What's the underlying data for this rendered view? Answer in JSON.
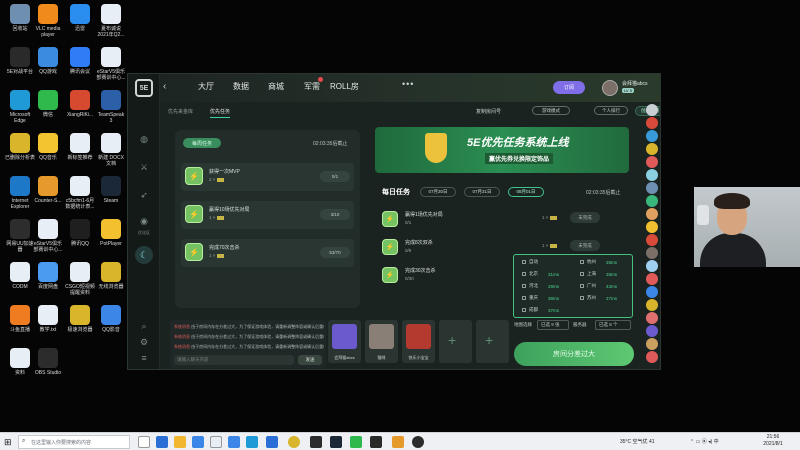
{
  "desktop_icons": [
    {
      "label": "回收站",
      "icon": "recycle-bin-icon",
      "color": "#6f8fb0"
    },
    {
      "label": "VLC media\nplayer",
      "icon": "vlc-icon",
      "color": "#f08a1d"
    },
    {
      "label": "迅雷",
      "icon": "thunder-icon",
      "color": "#2a8ef0"
    },
    {
      "label": "夏布诚说\n2021年Q2...",
      "icon": "document-icon",
      "color": "#e8eef5"
    },
    {
      "label": "5E对战平台",
      "icon": "5e-icon",
      "color": "#2a2a2a"
    },
    {
      "label": "QQ游戏",
      "icon": "qqgame-icon",
      "color": "#3b8be0"
    },
    {
      "label": "腾讯会议",
      "icon": "meeting-icon",
      "color": "#2f7cf6"
    },
    {
      "label": "eStarV5俱乐\n部赛训中心...",
      "icon": "document-icon",
      "color": "#e8eef5"
    },
    {
      "label": "Microsoft\nEdge",
      "icon": "edge-icon",
      "color": "#1f9ad6"
    },
    {
      "label": "微信",
      "icon": "wechat-icon",
      "color": "#2fb84b"
    },
    {
      "label": "XiangRiKi...",
      "icon": "app-icon",
      "color": "#d64a2f"
    },
    {
      "label": "TeamSpeak\n3",
      "icon": "teamspeak-icon",
      "color": "#2b5fa8"
    },
    {
      "label": "已删除分析表",
      "icon": "chrome-icon",
      "color": "#d9b52c"
    },
    {
      "label": "QQ音乐",
      "icon": "qqmusic-icon",
      "color": "#f4c430"
    },
    {
      "label": "新标签推荐",
      "icon": "document-icon",
      "color": "#e8eef5"
    },
    {
      "label": "新建 DOCX\n文档",
      "icon": "docx-icon",
      "color": "#e8eef5"
    },
    {
      "label": "Internet\nExplorer",
      "icon": "ie-icon",
      "color": "#1e78c8"
    },
    {
      "label": "Counter-S...",
      "icon": "csgo-icon",
      "color": "#e59a2b"
    },
    {
      "label": "c5bcfm1-6月\n数据统计表...",
      "icon": "document-icon",
      "color": "#e8eef5"
    },
    {
      "label": "Steam",
      "icon": "steam-icon",
      "color": "#1b2838"
    },
    {
      "label": "网易UU加速\n器",
      "icon": "uu-icon",
      "color": "#2d2d2d"
    },
    {
      "label": "eStarV5俱乐\n部赛训中心...",
      "icon": "document-icon",
      "color": "#e8eef5"
    },
    {
      "label": "腾讯QQ",
      "icon": "qq-icon",
      "color": "#1f1f1f"
    },
    {
      "label": "PotPlayer",
      "icon": "potplayer-icon",
      "color": "#f3c02f"
    },
    {
      "label": "CODM",
      "icon": "document-icon",
      "color": "#e8eef5"
    },
    {
      "label": "百度网盘",
      "icon": "baidu-icon",
      "color": "#4b9bf0"
    },
    {
      "label": "CSGO短视频\n提醒资料",
      "icon": "document-icon",
      "color": "#e8eef5"
    },
    {
      "label": "无线浏览器",
      "icon": "chrome-icon",
      "color": "#d9b52c"
    },
    {
      "label": "斗鱼直播",
      "icon": "douyu-icon",
      "color": "#f07c22"
    },
    {
      "label": "教学.txt",
      "icon": "document-icon",
      "color": "#e8eef5"
    },
    {
      "label": "极速浏览器",
      "icon": "chrome-icon",
      "color": "#d9b52c"
    },
    {
      "label": "QQ影音",
      "icon": "qqvideo-icon",
      "color": "#3b86e6"
    },
    {
      "label": "资料",
      "icon": "document-icon",
      "color": "#e8eef5"
    },
    {
      "label": "OBS Studio",
      "icon": "obs-icon",
      "color": "#2c2c2c"
    }
  ],
  "app": {
    "logo": "5E",
    "left_nav": [
      {
        "icon": "globe-icon",
        "label": ""
      },
      {
        "icon": "swords-icon",
        "label": ""
      },
      {
        "icon": "rocket-icon",
        "label": ""
      },
      {
        "icon": "wifi-icon",
        "label": "优化区"
      }
    ],
    "tabs": [
      "大厅",
      "数据",
      "商城",
      "军需",
      "ROLL房"
    ],
    "more_label": "•••",
    "login_button": "订阅",
    "user": {
      "name": "会拜猫abcs",
      "level": "LV 5"
    },
    "subtabs": [
      "优先来金库",
      "优先任务"
    ],
    "sub_links": {
      "copy_room": "复制房间号",
      "mode": "游戏模式",
      "solo": "个人排行",
      "create_room": "创建房间"
    },
    "weekly": {
      "label": "每周任务",
      "countdown": "02:03:35后截止",
      "tasks": [
        {
          "name": "获得一次MVP",
          "reward": "2 ×",
          "progress": "0/1"
        },
        {
          "name": "赢得10场优先对局",
          "reward": "1 ×",
          "progress": "3/10"
        },
        {
          "name": "完成70次击杀",
          "reward": "1 ×",
          "progress": "53/70"
        }
      ]
    },
    "banner": {
      "title": "5E优先任务系统上线",
      "subtitle": "赢优先券兑换限定饰品"
    },
    "daily": {
      "title": "每日任务",
      "dates": [
        "07月30日",
        "07月31日",
        "08月01日"
      ],
      "countdown": "02:03:35后截止",
      "tasks": [
        {
          "name": "赢得1场优先对局",
          "progress": "0/1",
          "reward": "1 ×",
          "status": "未完成"
        },
        {
          "name": "完成8次双杀",
          "progress": "0/8",
          "reward": "1 ×",
          "status": "未完成"
        },
        {
          "name": "完成30次击杀",
          "progress": "0/30",
          "reward": "1 ×",
          "status": "未完成"
        }
      ]
    },
    "servers": [
      {
        "name": "自动",
        "ping": ""
      },
      {
        "name": "杭州",
        "ping": "28ms"
      },
      {
        "name": "北京",
        "ping": "31ms"
      },
      {
        "name": "上海",
        "ping": "28ms"
      },
      {
        "name": "河北",
        "ping": "29ms"
      },
      {
        "name": "广州",
        "ping": "43ms"
      },
      {
        "name": "重庆",
        "ping": "38ms"
      },
      {
        "name": "苏州",
        "ping": "27ms"
      },
      {
        "name": "成都",
        "ping": "37ms"
      },
      {
        "name": "",
        "ping": ""
      }
    ],
    "server_footer": {
      "region_label": "地图选择",
      "region_value": "已选 9 张",
      "server_label": "服务器",
      "server_value": "已选 8 个"
    },
    "chat": {
      "lines": [
        {
          "name": "系统消息",
          "text": "由于房间内存在分差过大，为了保证游戏体验，请重新调整阵容或确认后重新开始匹配",
          "time": "21:50:1"
        },
        {
          "name": "系统消息",
          "text": "由于房间内存在分差过大，为了保证游戏体验，请重新调整阵容或确认后重新开始匹配",
          "time": "21:50:1"
        },
        {
          "name": "系统消息",
          "text": "由于房间内存在分差过大，为了保证游戏体验，请重新调整阵容或确认后重新开始匹配",
          "time": "21:51:0"
        }
      ],
      "placeholder": "请输入聊天内容",
      "send": "发送"
    },
    "party": [
      {
        "name": "会拜猫abcs",
        "type": "member",
        "color": "#6a5acd"
      },
      {
        "name": "猫咪",
        "type": "member",
        "color": "#8a7f76"
      },
      {
        "name": "快乐小宝宝",
        "type": "member",
        "color": "#b43a2f"
      },
      {
        "name": "",
        "type": "empty"
      },
      {
        "name": "",
        "type": "empty"
      }
    ],
    "match_button": "房间分差过大"
  },
  "right_avatars": [
    "#c9d0d4",
    "#d84a3a",
    "#3a9ad9",
    "#d9b52c",
    "#e05a5a",
    "#8ad0e0",
    "#6f8fb0",
    "#3ab87c",
    "#e0a060",
    "#f0c030",
    "#d84a3a",
    "#7c6f68",
    "#a0d0f0",
    "#e05a5a",
    "#3b86e6",
    "#d9b52c",
    "#e07070",
    "#6a5acd",
    "#c9a060",
    "#e05a5a"
  ],
  "taskbar": {
    "search_placeholder": "在这里输入你要搜索的内容",
    "weather": "35°C 空气优 41",
    "time": "21:56",
    "date": "2021/8/1"
  }
}
